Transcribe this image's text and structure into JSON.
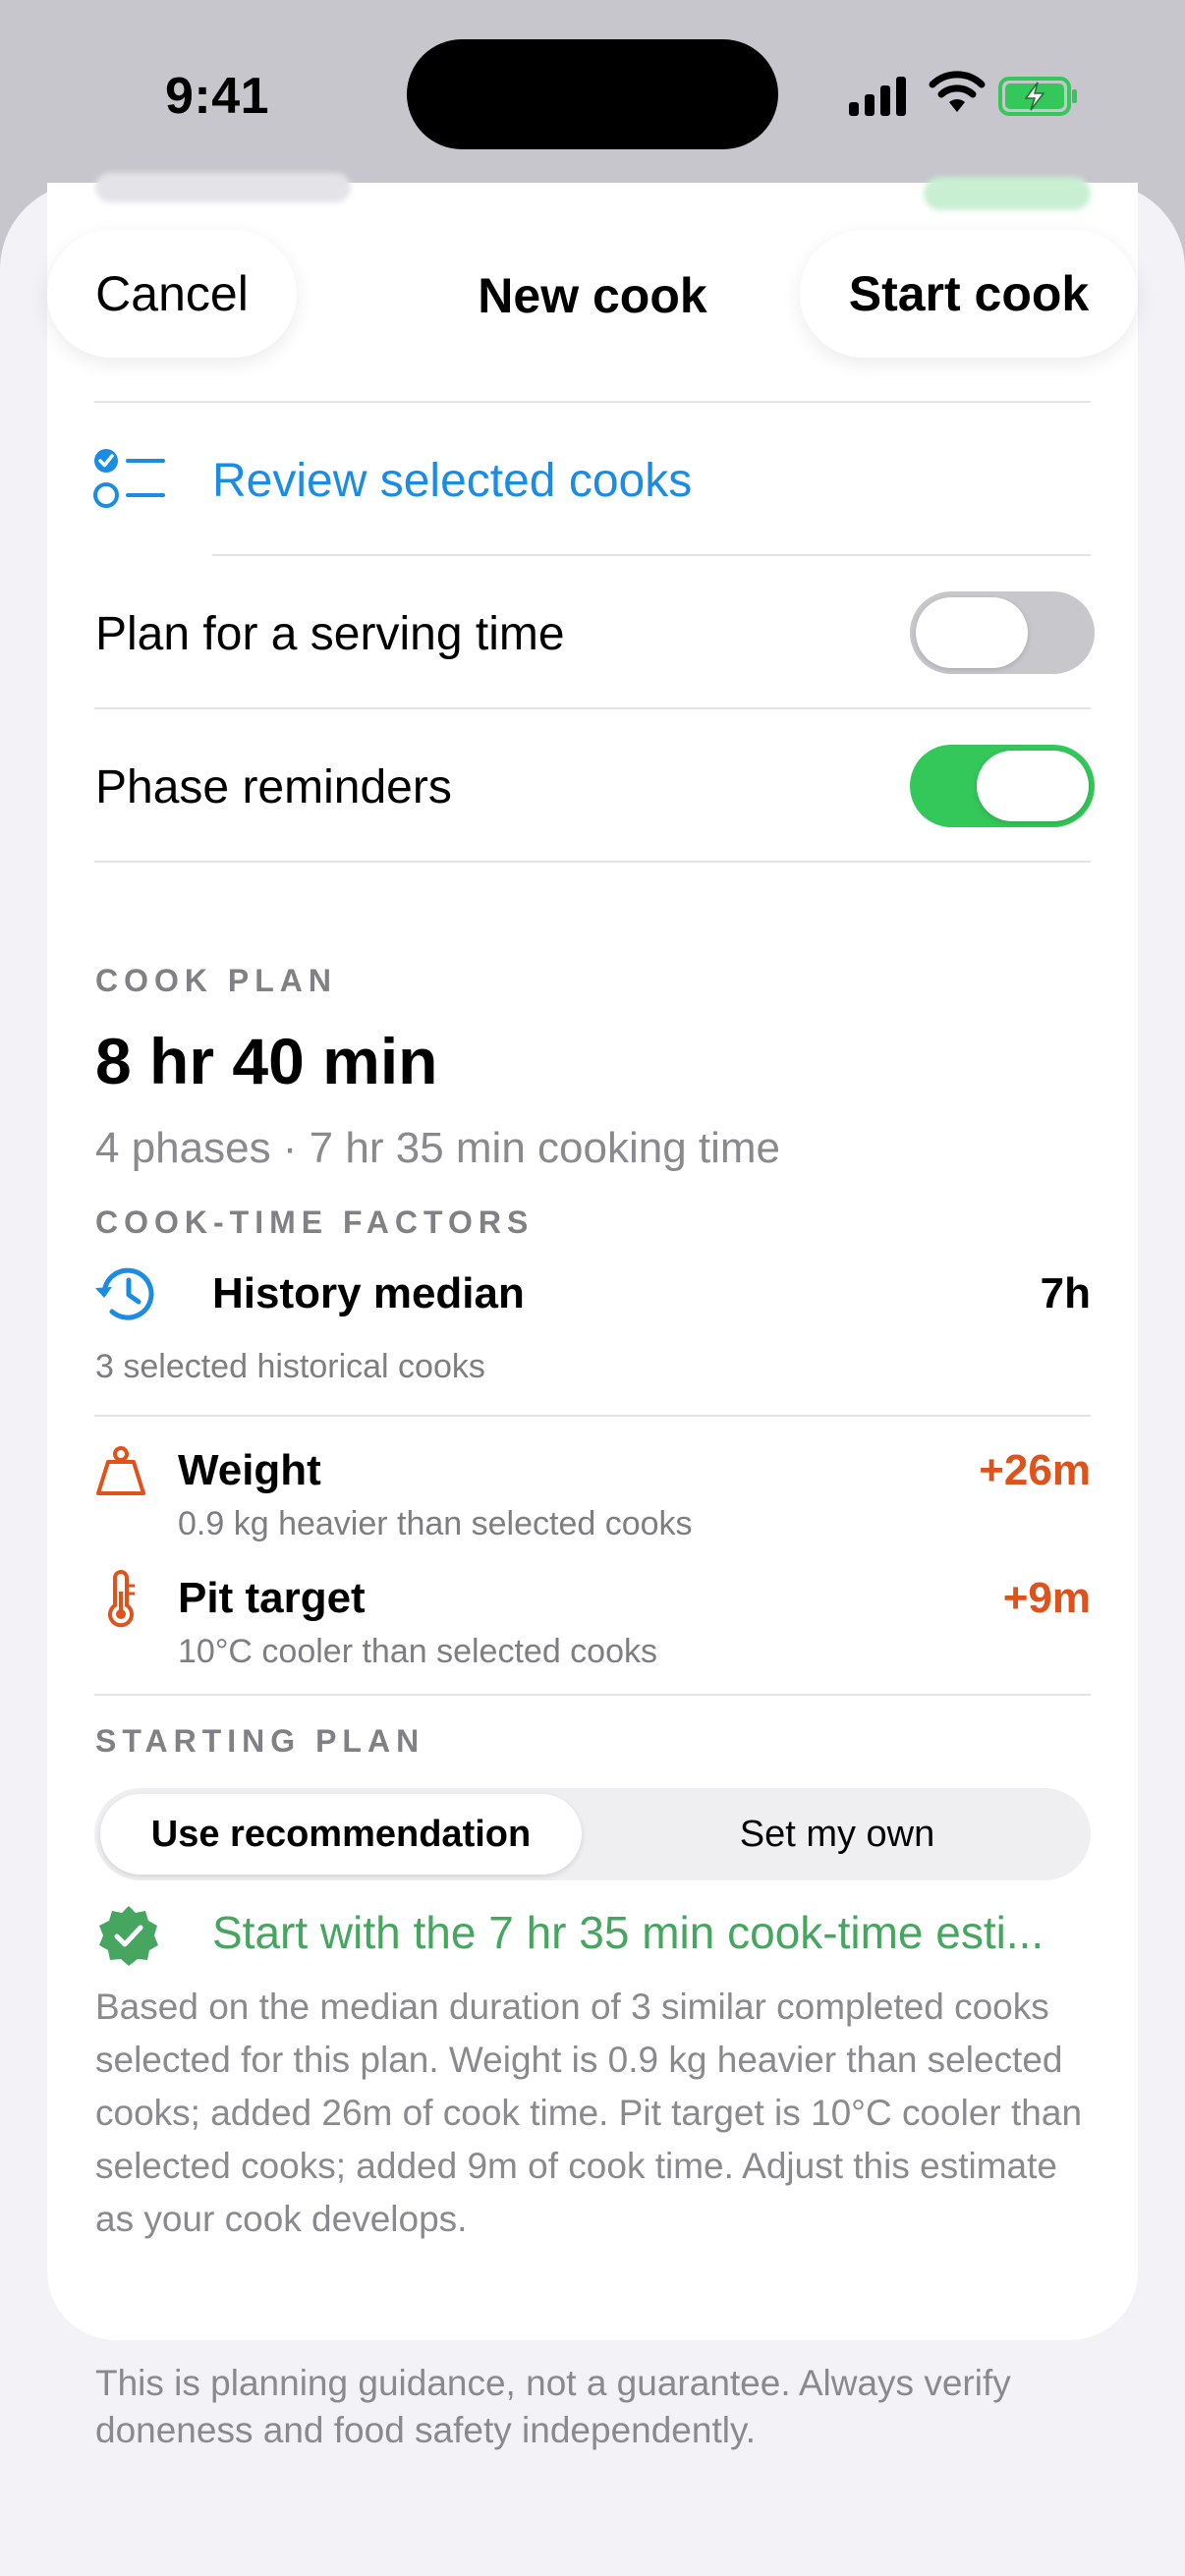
{
  "status_bar": {
    "time": "9:41"
  },
  "nav": {
    "cancel": "Cancel",
    "title": "New cook",
    "start": "Start cook"
  },
  "rows": {
    "review": "Review selected cooks",
    "serving_time": {
      "label": "Plan for a serving time",
      "on": false
    },
    "phase_reminders": {
      "label": "Phase reminders",
      "on": true
    }
  },
  "cook_plan": {
    "label": "COOK PLAN",
    "total": "8 hr 40 min",
    "summary": "4 phases · 7 hr 35 min cooking time"
  },
  "factors": {
    "label": "COOK-TIME FACTORS",
    "history": {
      "title": "History median",
      "value": "7h",
      "sub": "3 selected historical cooks"
    },
    "weight": {
      "title": "Weight",
      "value": "+26m",
      "sub": "0.9 kg heavier than selected cooks"
    },
    "pit": {
      "title": "Pit target",
      "value": "+9m",
      "sub": "10°C cooler than selected cooks"
    }
  },
  "starting_plan": {
    "label": "STARTING PLAN",
    "options": [
      "Use recommendation",
      "Set my own"
    ],
    "recommendation_title": "Start with the 7 hr 35 min cook-time esti...",
    "recommendation_body": "Based on the median duration of 3 similar completed cooks selected for this plan. Weight is 0.9 kg heavier than selected cooks; added 26m of cook time. Pit target is 10°C cooler than selected cooks; added 9m of cook time. Adjust this estimate as your cook develops."
  },
  "footer": "This is planning guidance, not a guarantee. Always verify doneness and food safety independently.",
  "colors": {
    "accent_blue": "#1a8ce3",
    "toggle_green": "#34c759",
    "warn_orange": "#e0521c",
    "rec_green": "#46a660"
  }
}
